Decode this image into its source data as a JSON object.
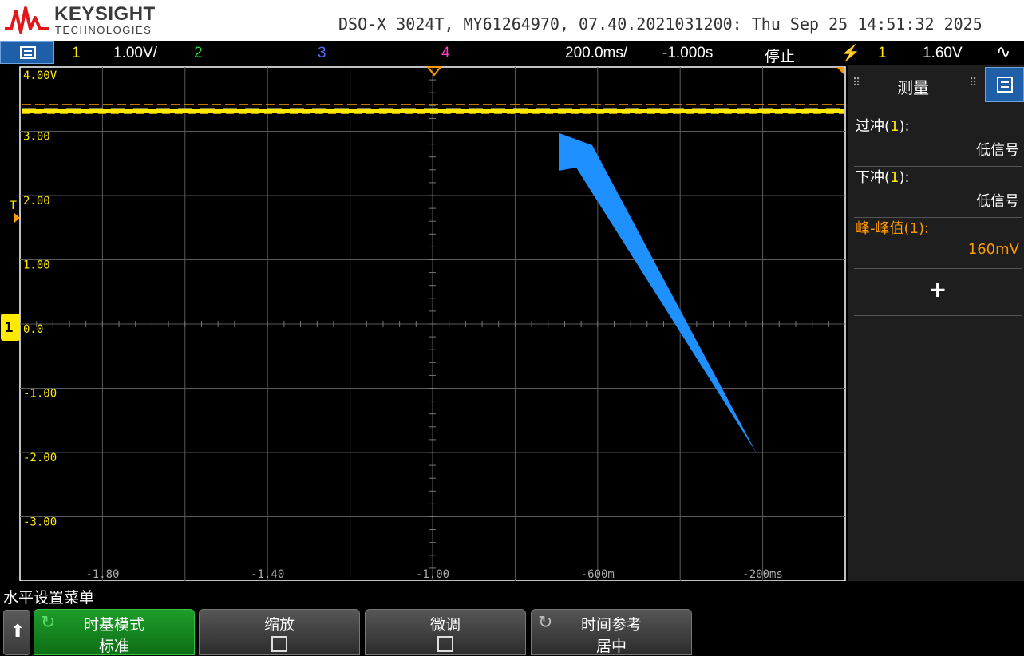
{
  "header": {
    "brand": "KEYSIGHT",
    "brand_sub": "TECHNOLOGIES",
    "instrument_info": "DSO-X 3024T, MY61264970, 07.40.2021031200: Thu Sep 25 14:51:32 2025"
  },
  "statusbar": {
    "ch1_num": "1",
    "ch1_scale": "1.00V/",
    "ch2_num": "2",
    "ch3_num": "3",
    "ch4_num": "4",
    "timebase": "200.0ms/",
    "delay": "-1.000s",
    "run_state": "停止",
    "trigger_source": "1",
    "trigger_level": "1.60V"
  },
  "colors": {
    "ch1": "#ffea00",
    "ch2": "#27e03a",
    "ch3": "#4f6bff",
    "ch4": "#ff3fbf",
    "trigger": "#ff9a00",
    "annotation_arrow": "#1e90ff"
  },
  "scope": {
    "y_labels": [
      "4.00V",
      "3.00",
      "2.00",
      "1.00",
      "0.0",
      "-1.00",
      "-2.00",
      "-3.00"
    ],
    "x_labels": [
      "-1.80",
      "-1.40",
      "-1.00",
      "-600m",
      "-200ms"
    ],
    "trigger_marker": "T",
    "ch1_ground_label": "1"
  },
  "panel": {
    "title": "测量",
    "drag_glyph": "⠿",
    "measurements": [
      {
        "label": "过冲(",
        "channel": "1",
        "label_end": "):",
        "value": "低信号",
        "highlight": false
      },
      {
        "label": "下冲(",
        "channel": "1",
        "label_end": "):",
        "value": "低信号",
        "highlight": false
      },
      {
        "label": "峰-峰值(1):",
        "channel": "",
        "label_end": "",
        "value": "160mV",
        "highlight": true
      }
    ],
    "add_label": "+"
  },
  "softkeys": {
    "menu_title": "水平设置菜单",
    "up_arrow": "⬆",
    "items": [
      {
        "line1": "时基模式",
        "line2": "标准",
        "active": true
      },
      {
        "line1": "缩放",
        "line2": "",
        "active": false
      },
      {
        "line1": "微调",
        "line2": "",
        "active": false
      },
      {
        "line1": "时间参考",
        "line2": "居中",
        "active": false
      }
    ]
  }
}
